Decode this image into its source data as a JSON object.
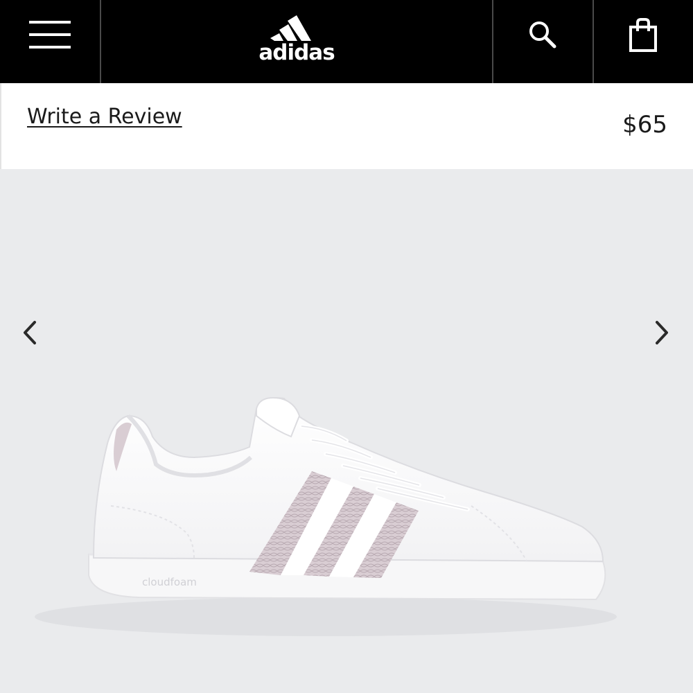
{
  "header": {
    "brand": "adidas",
    "icons": {
      "menu": "menu-icon",
      "search": "search-icon",
      "bag": "shopping-bag-icon"
    },
    "background": "#000000"
  },
  "product_bar": {
    "review_link": "Write a Review",
    "price": "$65"
  },
  "gallery": {
    "background": "#eaebed",
    "shoe_text": "cloudfoam",
    "prev_icon": "chevron-left-icon",
    "next_icon": "chevron-right-icon",
    "stripe_color": "#d9cdd3"
  }
}
